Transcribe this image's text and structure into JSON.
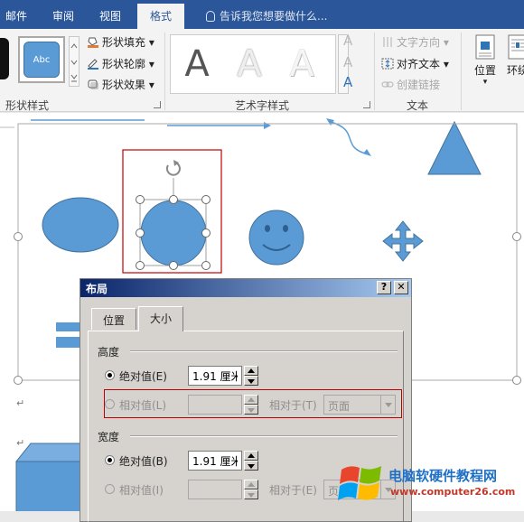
{
  "ribbon_tabs": [
    "邮件",
    "审阅",
    "视图",
    "格式"
  ],
  "active_tab": "格式",
  "tell_me": "告诉我您想要做什么...",
  "shape_styles": {
    "preview_text": "Abc",
    "fill": "形状填充",
    "outline": "形状轮廓",
    "effects": "形状效果",
    "group_label": "形状样式"
  },
  "wordart": {
    "letter": "A",
    "group_label": "艺术字样式"
  },
  "text_group": {
    "direction": "文字方向",
    "align": "对齐文本",
    "link": "创建链接",
    "group_label": "文本"
  },
  "arrange": {
    "position": "位置",
    "wrap": "环绕"
  },
  "dialog": {
    "title": "布局",
    "help_btn": "?",
    "close_btn": "✕",
    "tabs": [
      "位置",
      "大小"
    ],
    "active_tab": "大小",
    "height": {
      "section": "高度",
      "absolute_label": "绝对值(E)",
      "absolute_value": "1.91 厘米",
      "relative_label": "相对值(L)",
      "relative_to_label": "相对于(T)",
      "relative_to_value": "页面"
    },
    "width": {
      "section": "宽度",
      "absolute_label": "绝对值(B)",
      "absolute_value": "1.91 厘米",
      "relative_label": "相对值(I)",
      "relative_to_label": "相对于(E)",
      "relative_to_value": "页面"
    }
  },
  "paragraph_mark": "↵",
  "watermark": {
    "title": "电脑软硬件教程网",
    "url": "www.computer26.com"
  },
  "colors": {
    "ribbon_blue": "#2b579a",
    "shape_fill": "#5b9bd5",
    "shape_stroke": "#41719c",
    "highlight_red": "#c00000"
  }
}
